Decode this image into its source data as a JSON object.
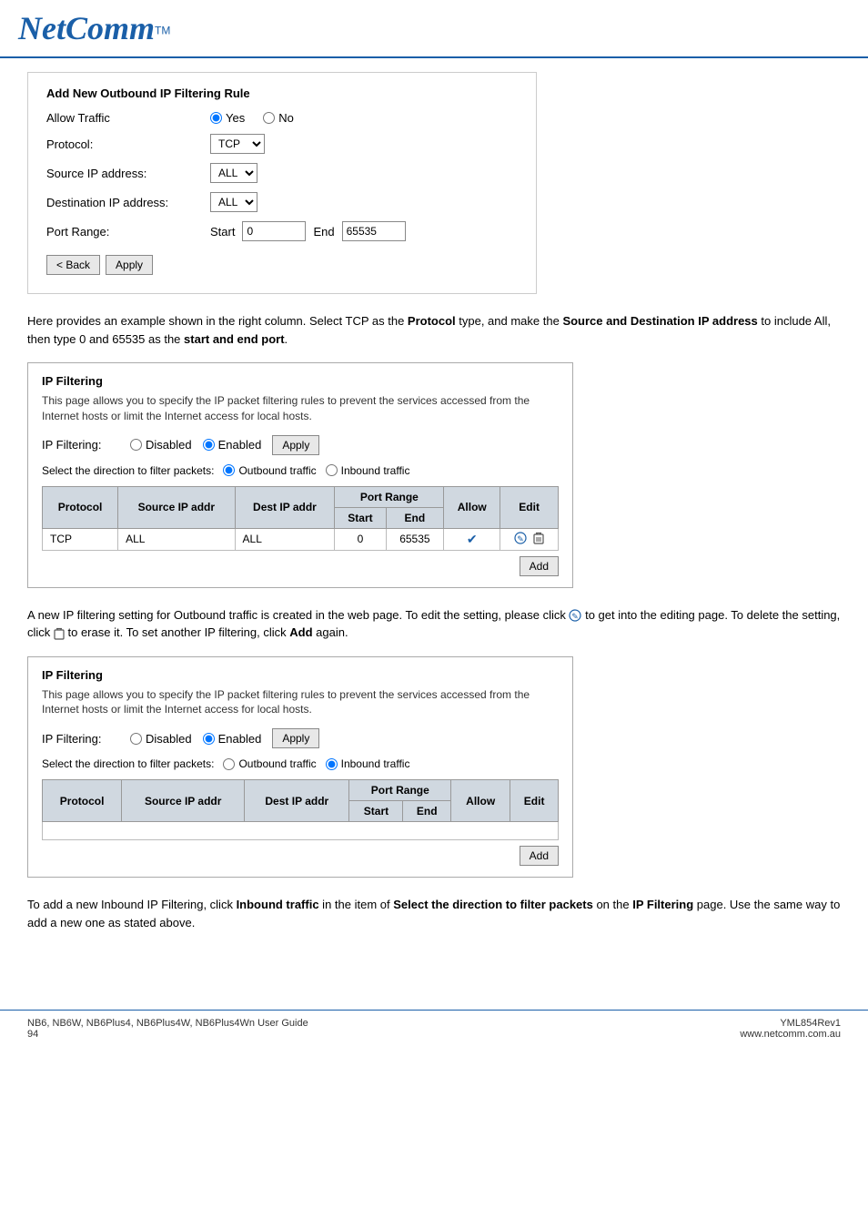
{
  "header": {
    "logo": "NetComm",
    "tm": "TM"
  },
  "form_section": {
    "title": "Add New Outbound IP Filtering Rule",
    "allow_traffic_label": "Allow Traffic",
    "yes_label": "Yes",
    "no_label": "No",
    "protocol_label": "Protocol:",
    "protocol_value": "TCP",
    "source_ip_label": "Source IP address:",
    "source_ip_value": "ALL",
    "dest_ip_label": "Destination IP address:",
    "dest_ip_value": "ALL",
    "port_range_label": "Port Range:",
    "start_label": "Start",
    "start_value": "0",
    "end_label": "End",
    "end_value": "65535",
    "back_btn": "< Back",
    "apply_btn": "Apply"
  },
  "paragraph1": "Here provides an example shown in the right column. Select TCP as the Protocol type, and make the Source and Destination IP address to include All, then type 0 and 65535 as the start and end port.",
  "paragraph1_bold": [
    "Protocol",
    "Source and Destination IP address",
    "start and end port"
  ],
  "ip_filter_panel1": {
    "title": "IP Filtering",
    "description": "This page allows you to specify the IP packet filtering rules to prevent the services accessed from the Internet hosts or limit the Internet access for local hosts.",
    "filtering_label": "IP Filtering:",
    "disabled_label": "Disabled",
    "enabled_label": "Enabled",
    "apply_btn": "Apply",
    "direction_label": "Select the direction to filter packets:",
    "outbound_label": "Outbound traffic",
    "inbound_label": "Inbound traffic",
    "table": {
      "headers": [
        "Protocol",
        "Source IP addr",
        "Dest IP addr",
        "Port Range",
        "",
        "Allow",
        "Edit"
      ],
      "subheaders": [
        "Start",
        "End"
      ],
      "rows": [
        {
          "protocol": "TCP",
          "source": "ALL",
          "dest": "ALL",
          "start": "0",
          "end": "65535",
          "allow": "✔",
          "edit": "edit+delete"
        }
      ]
    },
    "add_btn": "Add"
  },
  "paragraph2": "A new IP filtering setting for Outbound traffic is created in the web page. To edit the setting, please click  to get into the editing page. To delete the setting, click   to erase it. To set another IP filtering, click Add again.",
  "paragraph2_bold": [
    "Add"
  ],
  "ip_filter_panel2": {
    "title": "IP Filtering",
    "description": "This page allows you to specify the IP packet filtering rules to prevent the services accessed from the Internet hosts or limit the Internet access for local hosts.",
    "filtering_label": "IP Filtering:",
    "disabled_label": "Disabled",
    "enabled_label": "Enabled",
    "apply_btn": "Apply",
    "direction_label": "Select the direction to filter packets:",
    "outbound_label": "Outbound traffic",
    "inbound_label": "Inbound traffic",
    "table": {
      "headers": [
        "Protocol",
        "Source IP addr",
        "Dest IP addr",
        "Port Range",
        "",
        "Allow",
        "Edit"
      ],
      "subheaders": [
        "Start",
        "End"
      ],
      "rows": []
    },
    "add_btn": "Add"
  },
  "paragraph3_parts": {
    "text1": "To add a new Inbound IP Filtering, click ",
    "bold1": "Inbound traffic",
    "text2": " in the item of ",
    "bold2": "Select the direction to filter packets",
    "text3": " on the ",
    "bold3": "IP Filtering",
    "text4": " page. Use the same way to add a new one as stated above."
  },
  "footer": {
    "left": "NB6, NB6W, NB6Plus4, NB6Plus4W, NB6Plus4Wn User Guide\n94",
    "right": "YML854Rev1\nwww.netcomm.com.au"
  }
}
